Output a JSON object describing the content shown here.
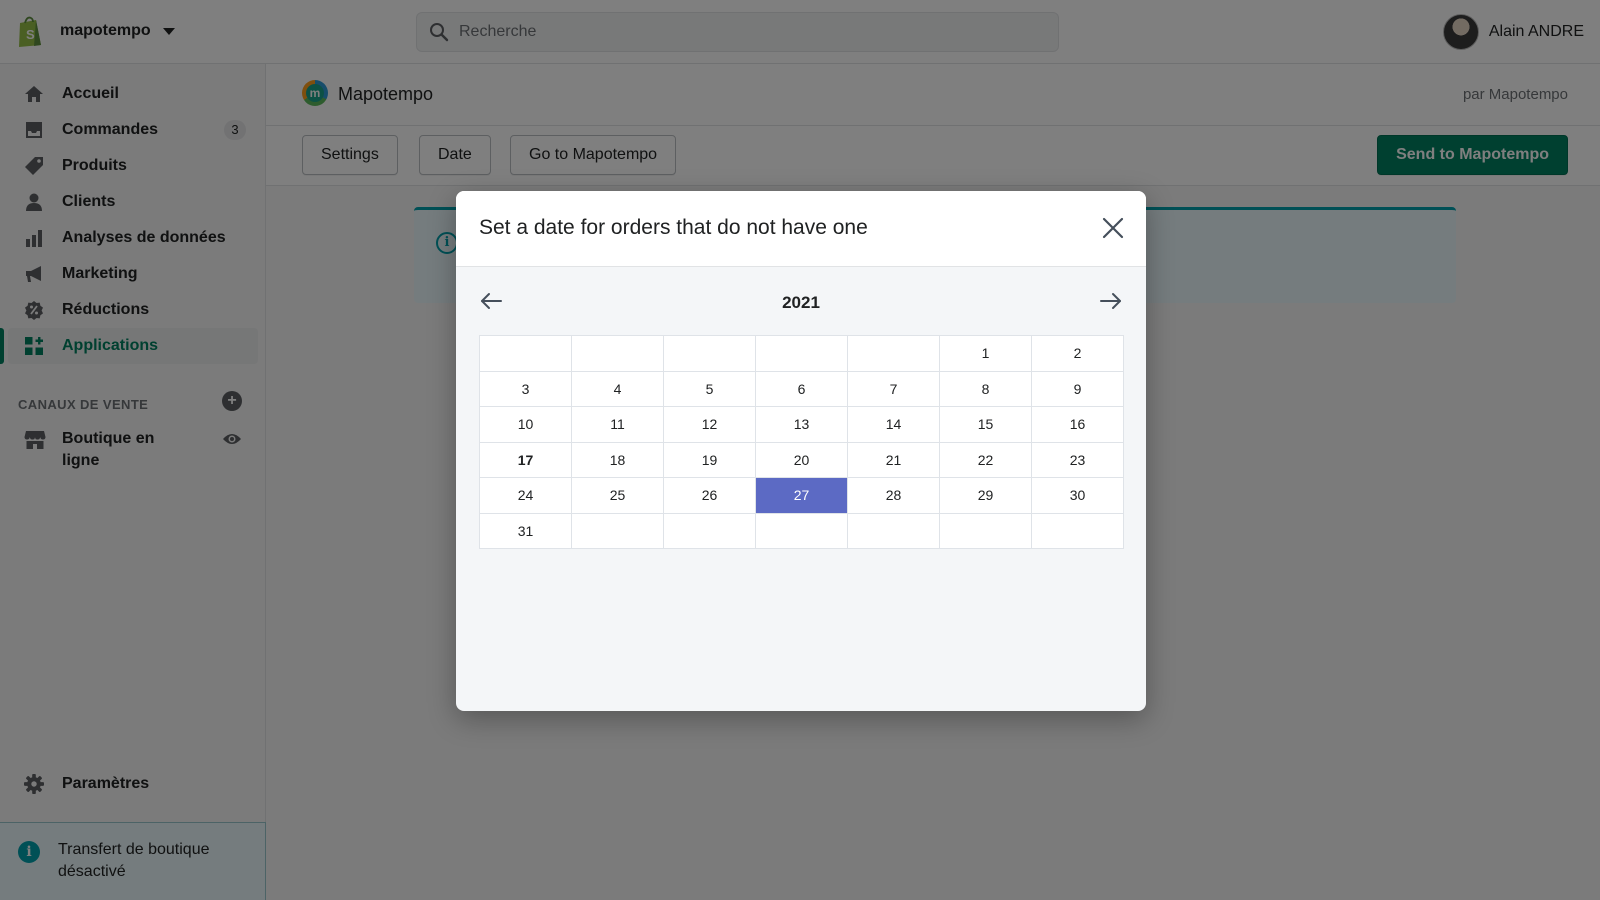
{
  "topbar": {
    "store_name": "mapotempo",
    "search_placeholder": "Recherche",
    "user_name": "Alain ANDRE"
  },
  "sidebar": {
    "items": [
      {
        "label": "Accueil",
        "icon": "home-icon"
      },
      {
        "label": "Commandes",
        "icon": "orders-icon",
        "badge": "3"
      },
      {
        "label": "Produits",
        "icon": "tag-icon"
      },
      {
        "label": "Clients",
        "icon": "person-icon"
      },
      {
        "label": "Analyses de données",
        "icon": "bar-chart-icon"
      },
      {
        "label": "Marketing",
        "icon": "megaphone-icon"
      },
      {
        "label": "Réductions",
        "icon": "discount-icon"
      },
      {
        "label": "Applications",
        "icon": "apps-icon",
        "active": true
      }
    ],
    "sales_channels_label": "CANAUX DE VENTE",
    "online_store_label": "Boutique en ligne",
    "settings_label": "Paramètres",
    "transfer_notice": "Transfert de boutique désactivé"
  },
  "app": {
    "title": "Mapotempo",
    "by": "par Mapotempo",
    "buttons": {
      "settings": "Settings",
      "date": "Date",
      "go_to": "Go to Mapotempo",
      "send": "Send to Mapotempo"
    }
  },
  "modal": {
    "title": "Set a date for orders that do not have one",
    "year": "2021",
    "today": 17,
    "selected": 27,
    "weeks": [
      [
        "",
        "",
        "",
        "",
        "",
        "1",
        "2"
      ],
      [
        "3",
        "4",
        "5",
        "6",
        "7",
        "8",
        "9"
      ],
      [
        "10",
        "11",
        "12",
        "13",
        "14",
        "15",
        "16"
      ],
      [
        "17",
        "18",
        "19",
        "20",
        "21",
        "22",
        "23"
      ],
      [
        "24",
        "25",
        "26",
        "27",
        "28",
        "29",
        "30"
      ],
      [
        "31",
        "",
        "",
        "",
        "",
        "",
        ""
      ]
    ]
  },
  "colors": {
    "accent": "#008060",
    "selected_day": "#5c6ac4",
    "info": "#00a0ac"
  }
}
